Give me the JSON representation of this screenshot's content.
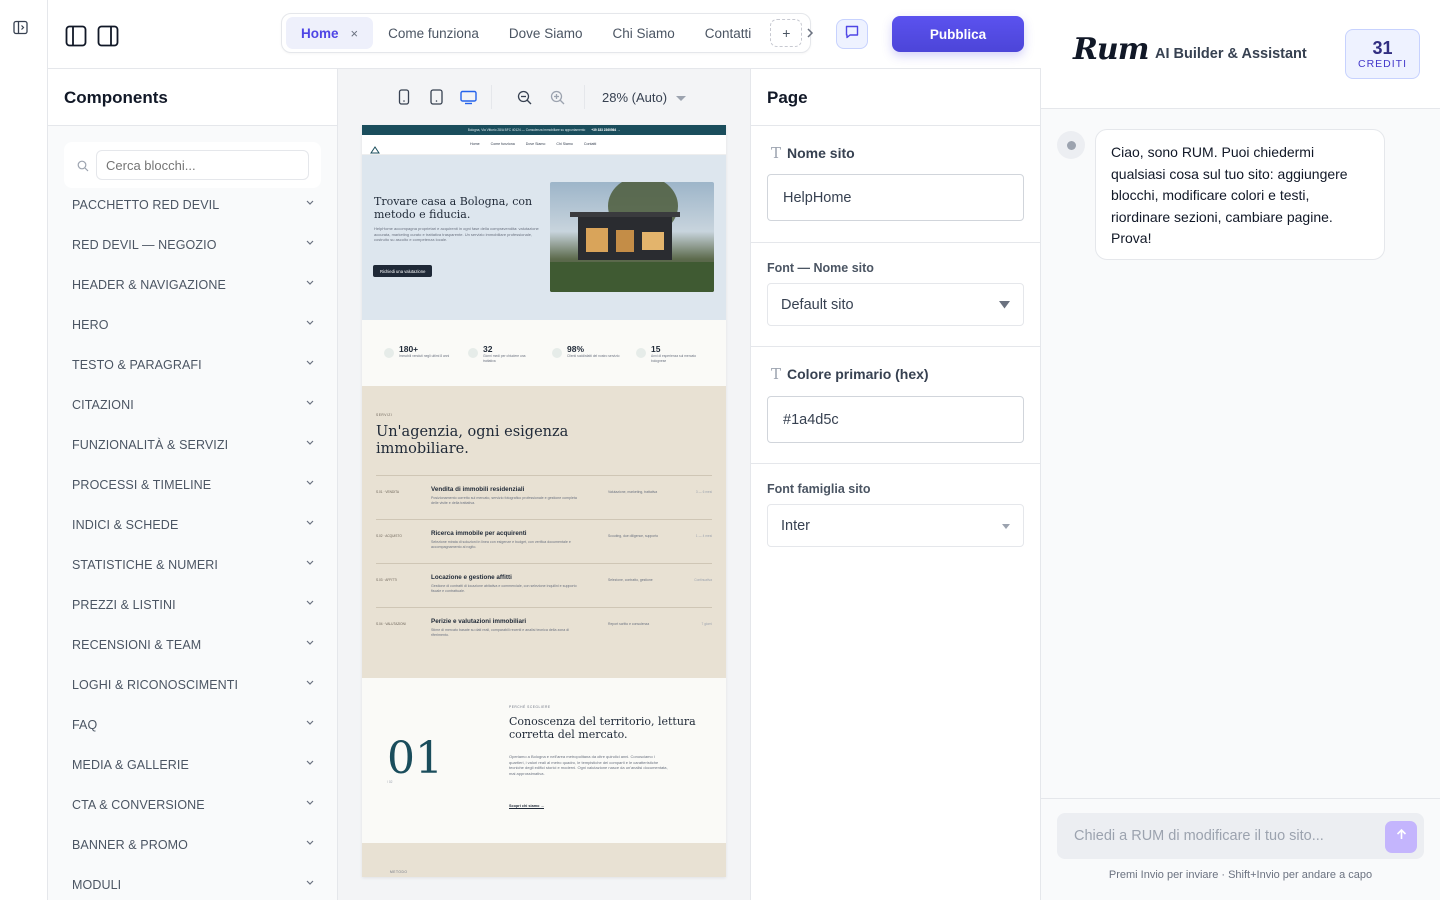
{
  "topbar": {
    "tabs": [
      {
        "label": "Home",
        "active": true
      },
      {
        "label": "Come funziona"
      },
      {
        "label": "Dove Siamo"
      },
      {
        "label": "Chi Siamo"
      },
      {
        "label": "Contatti"
      }
    ],
    "close_glyph": "×",
    "add_glyph": "+",
    "publish_label": "Pubblica",
    "icons": [
      "sidebar-toggle-icon",
      "layout-left-icon",
      "layout-right-icon",
      "chevron-right-icon",
      "chat-icon"
    ]
  },
  "components": {
    "title": "Components",
    "search_placeholder": "Cerca blocchi...",
    "categories": [
      "PACCHETTO RED DEVIL",
      "RED DEVIL — NEGOZIO",
      "HEADER & NAVIGAZIONE",
      "HERO",
      "TESTO & PARAGRAFI",
      "CITAZIONI",
      "FUNZIONALITÀ & SERVIZI",
      "PROCESSI & TIMELINE",
      "INDICI & SCHEDE",
      "STATISTICHE & NUMERI",
      "PREZZI & LISTINI",
      "RECENSIONI & TEAM",
      "LOGHI & RICONOSCIMENTI",
      "FAQ",
      "MEDIA & GALLERIE",
      "CTA & CONVERSIONE",
      "BANNER & PROMO",
      "MODULI"
    ]
  },
  "canvas": {
    "zoom_label": "28% (Auto)",
    "devices": [
      "mobile-icon",
      "tablet-icon",
      "desktop-icon"
    ],
    "active_device": "desktop-icon"
  },
  "preview": {
    "announce": "Bologna, Via Vittorio 28/A BFC 40124 — Consulenza immobiliare su appuntamento",
    "announce_phone": "+39 333 2360564 →",
    "nav": [
      "Home",
      "Come funziona",
      "Dove Siamo",
      "Chi Siamo",
      "Contatti"
    ],
    "hero_title": "Trovare casa a Bologna, con metodo e fiducia.",
    "hero_text": "HelpHome accompagna proprietari e acquirenti in ogni fase della compravendita: valutazione accurata, marketing curato e trattativa trasparente. Un servizio immobiliare professionale, costruito su ascolto e competenza locale.",
    "hero_cta": "Richiedi una valutazione",
    "stats": [
      {
        "value": "180+",
        "label": "Immobili venduti negli ultimi 8 anni"
      },
      {
        "value": "32",
        "label": "Giorni medi per chiudere una trattativa"
      },
      {
        "value": "98%",
        "label": "Clienti soddisfatti del nostro servizio"
      },
      {
        "value": "15",
        "label": "Anni di esperienza sul mercato bolognese"
      }
    ],
    "services_kicker": "SERVIZI",
    "services_title": "Un'agenzia, ogni esigenza immobiliare.",
    "services": [
      {
        "code": "S.01 · VENDITA",
        "title": "Vendita di immobili residenziali",
        "text": "Posizionamento corretto sul mercato, servizio fotografico professionale e gestione completa delle visite e della trattativa.",
        "tags": "Valutazione, marketing, trattativa",
        "time": "3 — 6 mesi"
      },
      {
        "code": "S.02 · ACQUISTO",
        "title": "Ricerca immobile per acquirenti",
        "text": "Selezione mirata di soluzioni in linea con esigenze e budget, con verifica documentale e accompagnamento al rogito.",
        "tags": "Scouting, due diligence, supporto",
        "time": "1 — 4 mesi"
      },
      {
        "code": "S.03 · AFFITTI",
        "title": "Locazione e gestione affitti",
        "text": "Gestione di contratti di locazione abitativa e commerciale, con selezione inquilini e supporto fiscale e contrattuale.",
        "tags": "Selezione, contratto, gestione",
        "time": "Continuativa"
      },
      {
        "code": "S.04 · VALUTAZIONI",
        "title": "Perizie e valutazioni immobiliari",
        "text": "Stime di mercato basate su dati reali, comparabili recenti e analisi tecnica della zona di riferimento.",
        "tags": "Report scritto e consulenza",
        "time": "7 giorni"
      }
    ],
    "big_number": "01",
    "big_number_sub": "/ 02",
    "about_kicker": "PERCHÉ SCEGLIERE",
    "about_title": "Conoscenza del territorio, lettura corretta del mercato.",
    "about_text": "Operiamo a Bologna e nell'area metropolitana da oltre quindici anni. Conosciamo i quartieri, i valori reali al metro quadro, le tempistiche dei comparti e le caratteristiche tecniche degli edifici storici e moderni. Ogni valutazione nasce da un'analisi documentata, mai approssimativa.",
    "about_link": "Scopri chi siamo →",
    "next_kicker": "METODO"
  },
  "page_panel": {
    "title": "Page",
    "site_name_label": "Nome sito",
    "site_name_value": "HelpHome",
    "font_name_label": "Font — Nome sito",
    "font_name_value": "Default sito",
    "primary_color_label": "Colore primario (hex)",
    "primary_color_value": "#1a4d5c",
    "font_family_label": "Font famiglia sito",
    "font_family_value": "Inter"
  },
  "assistant": {
    "logo_text": "Rum",
    "title": "AI Builder & Assistant",
    "credits_value": "31",
    "credits_label": "CREDITI",
    "message": "Ciao, sono RUM. Puoi chiedermi qualsiasi cosa sul tuo sito: aggiungere blocchi, modificare colori e testi, riordinare sezioni, cambiare pagine. Prova!",
    "input_placeholder": "Chiedi a RUM di modificare il tuo sito...",
    "hint": "Premi Invio per inviare · Shift+Invio per andare a capo"
  },
  "colors": {
    "accent": "#4f46e5",
    "site_primary": "#1a4d5c",
    "services_bg": "#e8e1d3",
    "hero_bg": "#dde6ee"
  }
}
